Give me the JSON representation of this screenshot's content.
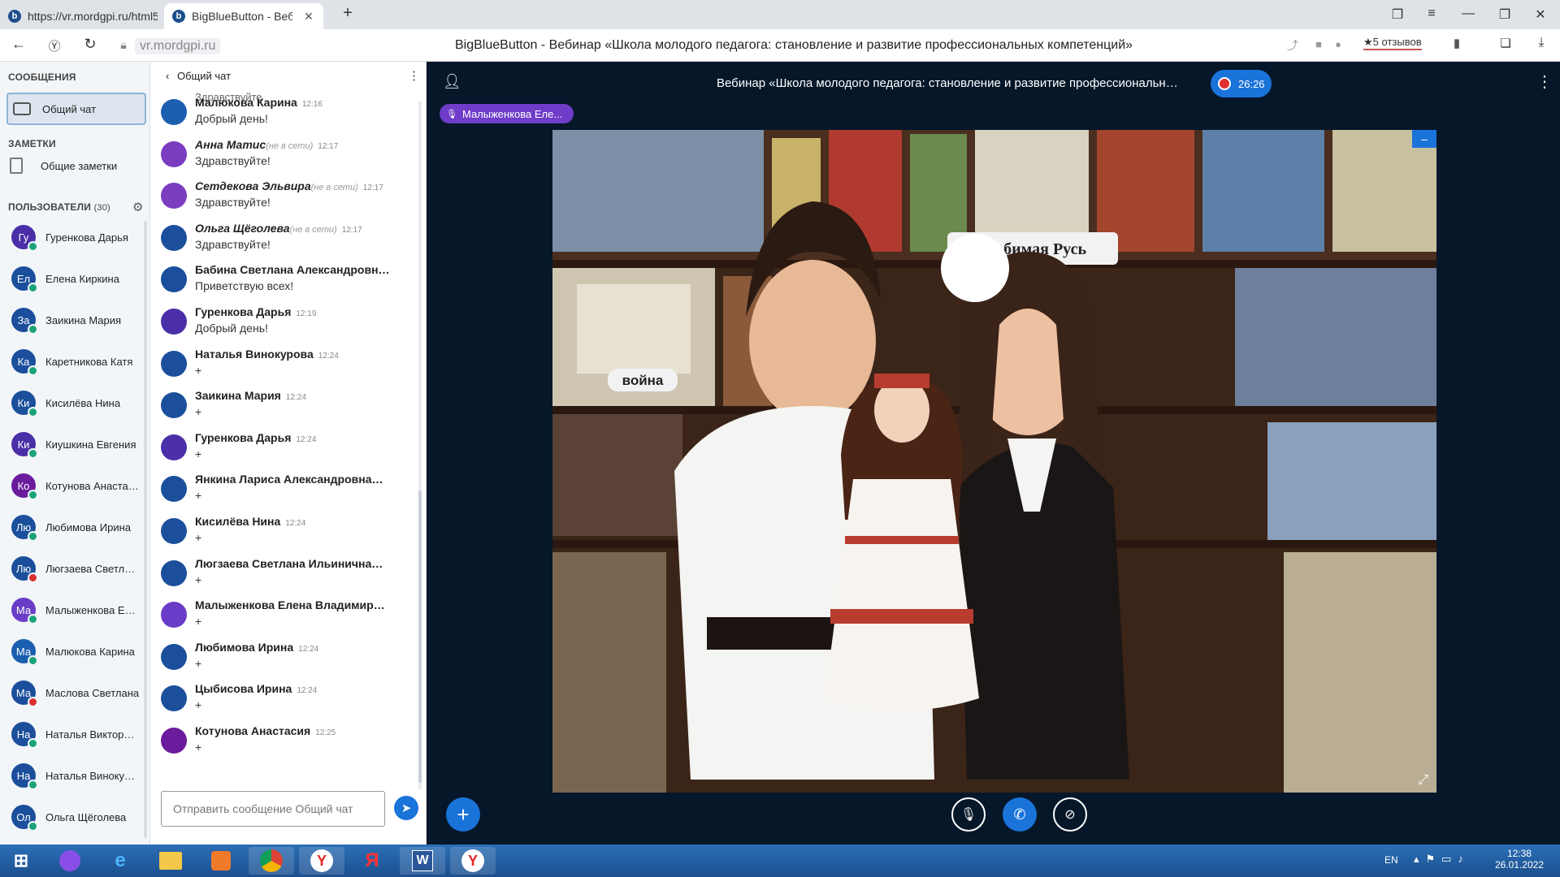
{
  "browser": {
    "tabs": [
      {
        "label": "https://vr.mordgpi.ru/html5"
      },
      {
        "label": "BigBlueButton - Веб"
      }
    ],
    "url": "vr.mordgpi.ru",
    "page_title": "BigBlueButton - Вебинар «Школа молодого педагога: становление и развитие профессиональных компетенций»",
    "reviews": "★5 отзывов"
  },
  "sidebar": {
    "messages_header": "СООБЩЕНИЯ",
    "public_chat": "Общий чат",
    "notes_header": "ЗАМЕТКИ",
    "shared_notes": "Общие заметки",
    "users_header": "ПОЛЬЗОВАТЕЛИ",
    "users_count": "(30)",
    "users": [
      {
        "initials": "Гу",
        "name": "Гуренкова Дарья",
        "color": "#4a2fa8",
        "mic": "listen"
      },
      {
        "initials": "Ел",
        "name": "Елена Киркина",
        "color": "#1b4f9c",
        "mic": "listen"
      },
      {
        "initials": "За",
        "name": "Заикина Мария",
        "color": "#1b4f9c",
        "mic": "listen"
      },
      {
        "initials": "Ка",
        "name": "Каретникова Катя",
        "color": "#1b4f9c",
        "mic": "listen"
      },
      {
        "initials": "Ки",
        "name": "Кисилёва Нина",
        "color": "#1b4f9c",
        "mic": "listen"
      },
      {
        "initials": "Ки",
        "name": "Киушкина Евгения",
        "color": "#4a2fa8",
        "mic": "listen"
      },
      {
        "initials": "Ко",
        "name": "Котунова Анастасия",
        "color": "#6a1c9c",
        "mic": "listen"
      },
      {
        "initials": "Лю",
        "name": "Любимова Ирина",
        "color": "#1b4f9c",
        "mic": "listen"
      },
      {
        "initials": "Лю",
        "name": "Люгзаева Светлана",
        "color": "#1b4f9c",
        "mic": "muted"
      },
      {
        "initials": "Ма",
        "name": "Малыженкова Елена",
        "color": "#6a3dc9",
        "mic": "listen"
      },
      {
        "initials": "Ма",
        "name": "Малюкова Карина",
        "color": "#1b5fb0",
        "mic": "listen"
      },
      {
        "initials": "Ма",
        "name": "Маслова Светлана",
        "color": "#1b4f9c",
        "mic": "muted"
      },
      {
        "initials": "На",
        "name": "Наталья Викторова",
        "color": "#1b4f9c",
        "mic": "listen"
      },
      {
        "initials": "На",
        "name": "Наталья Винокурова",
        "color": "#1b4f9c",
        "mic": "listen"
      },
      {
        "initials": "Ол",
        "name": "Ольга Щёголева",
        "color": "#1b4f9c",
        "mic": "listen"
      }
    ]
  },
  "chat": {
    "header": "Общий чат",
    "partial_top": "Здравствуйте",
    "input_placeholder": "Отправить сообщение Общий чат",
    "messages": [
      {
        "initials": "Ма",
        "color": "#1b5fb0",
        "name": "Малюкова Карина",
        "status": "",
        "time": "12:16",
        "text": "Добрый день!"
      },
      {
        "initials": "Ан",
        "color": "#7a3dbf",
        "name": "Анна Матис",
        "status": "(не в сети)",
        "time": "12:17",
        "text": "Здравствуйте!"
      },
      {
        "initials": "Се",
        "color": "#7a3dbf",
        "name": "Сетдекова Эльвира",
        "status": "(не в сети)",
        "time": "12:17",
        "text": "Здравствуйте!"
      },
      {
        "initials": "Ол",
        "color": "#1b4f9c",
        "name": "Ольга Щёголева",
        "status": "(не в сети)",
        "time": "12:17",
        "text": "Здравствуйте!"
      },
      {
        "initials": "Ба",
        "color": "#1b4f9c",
        "name": "Бабина Светлана Александровна",
        "status": "",
        "time": "12:19",
        "text": "Приветствую всех!"
      },
      {
        "initials": "Гу",
        "color": "#4a2fa8",
        "name": "Гуренкова Дарья",
        "status": "",
        "time": "12:19",
        "text": "Добрый день!"
      },
      {
        "initials": "На",
        "color": "#1b4f9c",
        "name": "Наталья Винокурова",
        "status": "",
        "time": "12:24",
        "text": "+"
      },
      {
        "initials": "За",
        "color": "#1b4f9c",
        "name": "Заикина Мария",
        "status": "",
        "time": "12:24",
        "text": "+"
      },
      {
        "initials": "Гу",
        "color": "#4a2fa8",
        "name": "Гуренкова Дарья",
        "status": "",
        "time": "12:24",
        "text": "+"
      },
      {
        "initials": "Ян",
        "color": "#1b4f9c",
        "name": "Янкина Лариса Александровна",
        "status": "",
        "time": "12:24",
        "text": "+"
      },
      {
        "initials": "Ки",
        "color": "#1b4f9c",
        "name": "Кисилёва Нина",
        "status": "",
        "time": "12:24",
        "text": "+"
      },
      {
        "initials": "Лю",
        "color": "#1b4f9c",
        "name": "Люгзаева Светлана Ильинична",
        "status": "",
        "time": "12:24",
        "text": "+"
      },
      {
        "initials": "Ма",
        "color": "#6a3dc9",
        "name": "Малыженкова Елена Владимировна",
        "status": "",
        "time": "12:24",
        "text": "+"
      },
      {
        "initials": "Лю",
        "color": "#1b4f9c",
        "name": "Любимова Ирина",
        "status": "",
        "time": "12:24",
        "text": "+"
      },
      {
        "initials": "Цы",
        "color": "#1b4f9c",
        "name": "Цыбисова Ирина",
        "status": "",
        "time": "12:24",
        "text": "+"
      },
      {
        "initials": "Ко",
        "color": "#6a1c9c",
        "name": "Котунова Анастасия",
        "status": "",
        "time": "12:25",
        "text": "+"
      }
    ]
  },
  "meeting": {
    "title": "Вебинар «Школа молодого педагога: становление и развитие профессиональных компетенций»",
    "recording_time": "26:26",
    "talking_user": "Малыженкова Еле...",
    "slide_sign_left": "война",
    "slide_sign_right": "Любимая Русь"
  },
  "taskbar": {
    "lang": "EN",
    "time": "12:38",
    "date": "26.01.2022"
  }
}
